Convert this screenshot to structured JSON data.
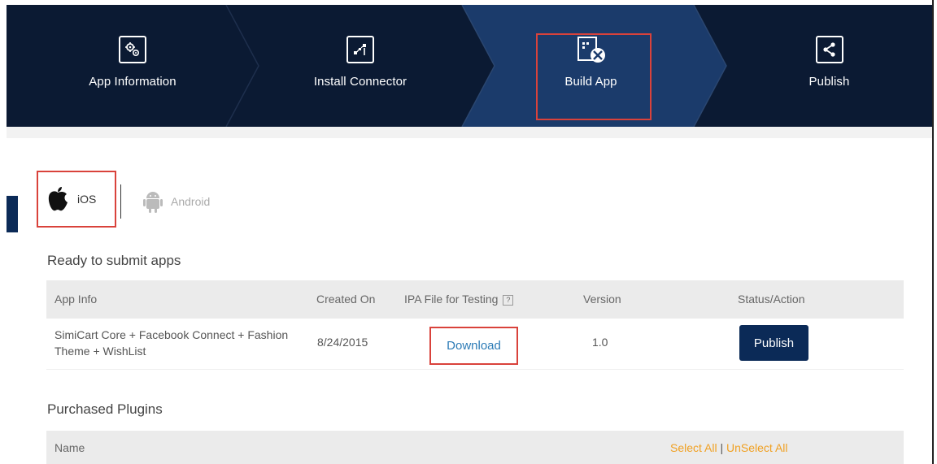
{
  "steps": [
    {
      "label": "App Information",
      "icon": "gears-icon"
    },
    {
      "label": "Install Connector",
      "icon": "connector-icon"
    },
    {
      "label": "Build App",
      "icon": "build-tools-icon",
      "active": true
    },
    {
      "label": "Publish",
      "icon": "share-icon"
    }
  ],
  "platforms": {
    "ios": {
      "label": "iOS",
      "icon": "apple-icon",
      "selected": true
    },
    "android": {
      "label": "Android",
      "icon": "android-icon",
      "selected": false
    }
  },
  "ready_section": {
    "title": "Ready to submit apps",
    "columns": [
      "App Info",
      "Created On",
      "IPA File for Testing",
      "Version",
      "Status/Action"
    ],
    "help_glyph": "?",
    "rows": [
      {
        "app_info": "SimiCart Core + Facebook Connect + Fashion",
        "app_info_line2": "Theme + WishList",
        "created_on": "8/24/2015",
        "ipa_link": "Download",
        "version": "1.0",
        "action": "Publish"
      }
    ]
  },
  "plugins_section": {
    "title": "Purchased Plugins",
    "name_header": "Name",
    "select_all": "Select All",
    "separator": "|",
    "unselect_all": "UnSelect All"
  },
  "colors": {
    "nav_bg": "#0b1a33",
    "nav_active": "#1b3b6b",
    "highlight": "#d9423b",
    "button": "#0b2a57",
    "link": "#2c7bb6",
    "select_link": "#f0a022"
  }
}
